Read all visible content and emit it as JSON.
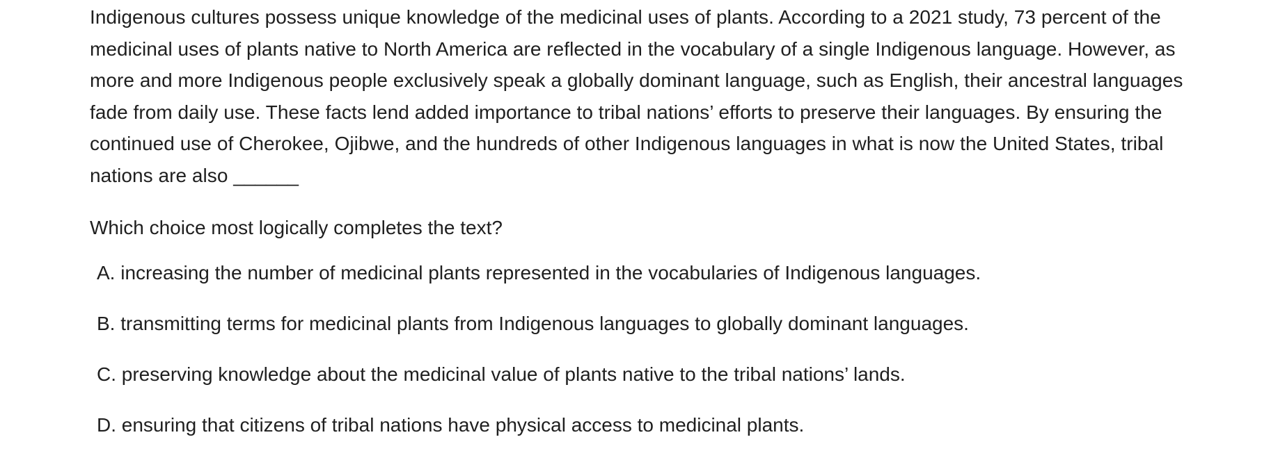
{
  "passage": "Indigenous cultures possess unique knowledge of the medicinal uses of plants. According to a 2021 study, 73 percent of the medicinal uses of plants native to North America are reflected in the vocabulary of a single Indigenous language. However, as more and more Indigenous people exclusively speak a globally dominant language, such as English, their ancestral languages fade from daily use. These facts lend added importance to tribal nations’ efforts to preserve their languages. By ensuring the continued use of Cherokee, Ojibwe, and the hundreds of other Indigenous languages in what is now the United States, tribal nations are also ______",
  "question": "Which choice most logically completes the text?",
  "choices": [
    {
      "letter": "A.",
      "text": "increasing the number of medicinal plants represented in the vocabularies of Indigenous languages."
    },
    {
      "letter": "B.",
      "text": "transmitting terms for medicinal plants from Indigenous languages to globally dominant languages."
    },
    {
      "letter": "C.",
      "text": "preserving knowledge about the medicinal value of plants native to the tribal nations’ lands."
    },
    {
      "letter": "D.",
      "text": "ensuring that citizens of tribal nations have physical access to medicinal plants."
    }
  ]
}
